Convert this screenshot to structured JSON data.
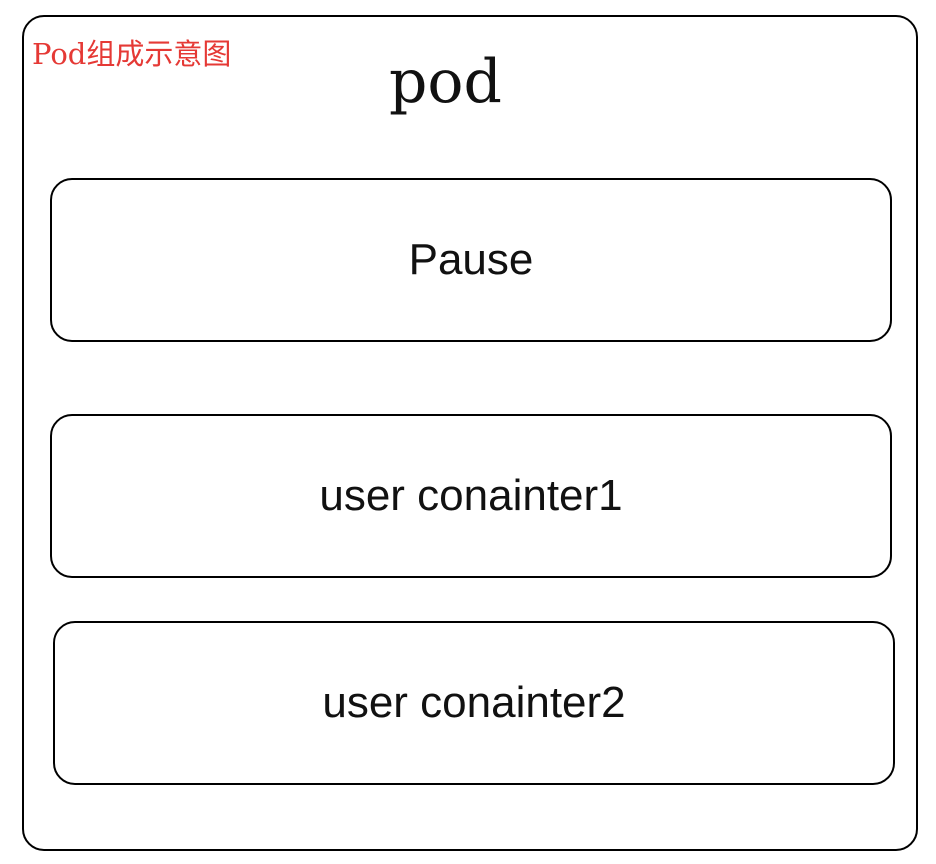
{
  "caption": "Pod组成示意图",
  "pod": {
    "title": "pod",
    "containers": [
      {
        "label": "Pause"
      },
      {
        "label": "user conainter1"
      },
      {
        "label": "user conainter2"
      }
    ]
  },
  "colors": {
    "caption": "#e53935",
    "stroke": "#000000",
    "text": "#111111",
    "background": "#ffffff"
  }
}
